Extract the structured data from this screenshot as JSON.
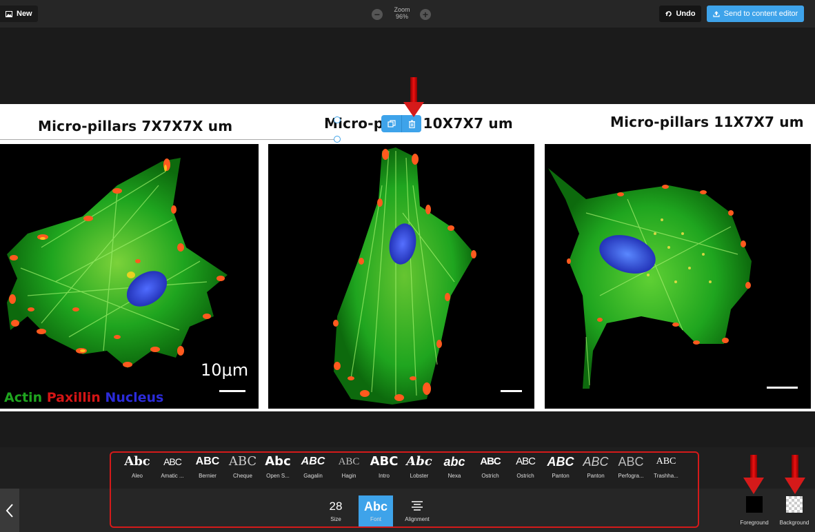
{
  "topbar": {
    "new_label": "New",
    "zoom_label": "Zoom",
    "zoom_value": "96%",
    "zoom_minus": "−",
    "zoom_plus": "+",
    "undo_label": "Undo",
    "send_label": "Send to content editor"
  },
  "canvas": {
    "titles": [
      "Micro-pillars 7X7X7X um",
      "Micro-p        10X7X7 um",
      "Micro-pillars 11X7X7 um"
    ],
    "scale_text": "10μm",
    "legend": {
      "actin": "Actin",
      "paxillin": "Paxillin",
      "nucleus": "Nucleus"
    },
    "colors": {
      "actin": "#1fa51f",
      "paxillin": "#d41515",
      "nucleus": "#2b2bd9",
      "accent": "#3ea3ea",
      "annotation": "#d51a1a"
    }
  },
  "fonts": [
    {
      "sample": "Abc",
      "name": "Aleo"
    },
    {
      "sample": "ABC",
      "name": "Amatic ..."
    },
    {
      "sample": "ABC",
      "name": "Bernier"
    },
    {
      "sample": "ABC",
      "name": "Cheque"
    },
    {
      "sample": "Abc",
      "name": "Open S..."
    },
    {
      "sample": "ABC",
      "name": "Gagalin"
    },
    {
      "sample": "ABC",
      "name": "Hagin"
    },
    {
      "sample": "ABC",
      "name": "Intro"
    },
    {
      "sample": "Abc",
      "name": "Lobster"
    },
    {
      "sample": "abc",
      "name": "Nexa"
    },
    {
      "sample": "ABC",
      "name": "Ostrich"
    },
    {
      "sample": "ABC",
      "name": "Ostrich"
    },
    {
      "sample": "ABC",
      "name": "Panton"
    },
    {
      "sample": "ABC",
      "name": "Panton"
    },
    {
      "sample": "ABC",
      "name": "Perfogra..."
    },
    {
      "sample": "ABC",
      "name": "Trashha..."
    }
  ],
  "controls": {
    "size_value": "28",
    "size_label": "Size",
    "font_value": "Abc",
    "font_label": "Font",
    "alignment_label": "Alignment"
  },
  "colors_panel": {
    "foreground_label": "Foreground",
    "background_label": "Background"
  }
}
